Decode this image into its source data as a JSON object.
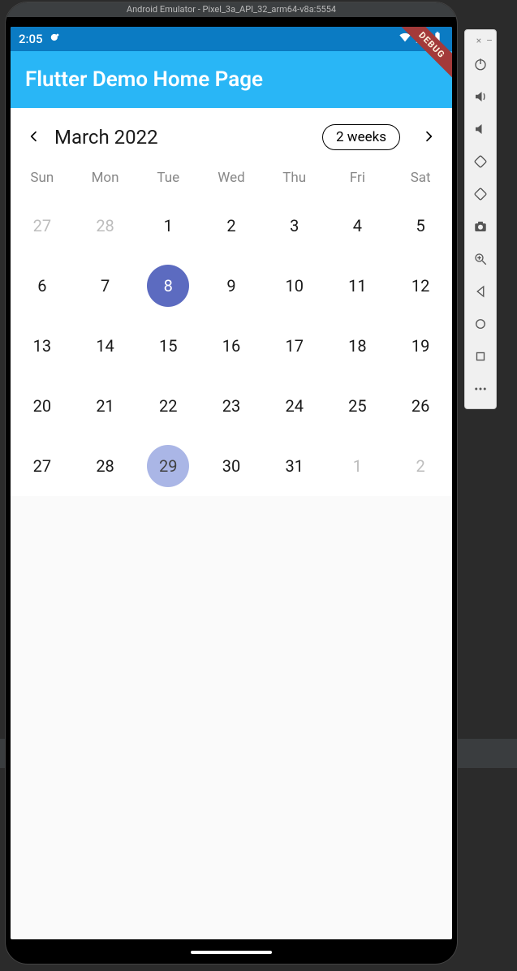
{
  "emulator": {
    "title": "Android Emulator - Pixel_3a_API_32_arm64-v8a:5554",
    "window_close": "×",
    "window_min": "–"
  },
  "status": {
    "time": "2:05"
  },
  "debug_banner": "DEBUG",
  "app": {
    "title": "Flutter Demo Home Page"
  },
  "calendar": {
    "month_label": "March 2022",
    "format_label": "2 weeks",
    "dow": [
      "Sun",
      "Mon",
      "Tue",
      "Wed",
      "Thu",
      "Fri",
      "Sat"
    ],
    "weeks": [
      [
        {
          "d": "27",
          "out": true
        },
        {
          "d": "28",
          "out": true
        },
        {
          "d": "1"
        },
        {
          "d": "2"
        },
        {
          "d": "3"
        },
        {
          "d": "4"
        },
        {
          "d": "5"
        }
      ],
      [
        {
          "d": "6"
        },
        {
          "d": "7"
        },
        {
          "d": "8",
          "selected": true
        },
        {
          "d": "9"
        },
        {
          "d": "10"
        },
        {
          "d": "11"
        },
        {
          "d": "12"
        }
      ],
      [
        {
          "d": "13"
        },
        {
          "d": "14"
        },
        {
          "d": "15"
        },
        {
          "d": "16"
        },
        {
          "d": "17"
        },
        {
          "d": "18"
        },
        {
          "d": "19"
        }
      ],
      [
        {
          "d": "20"
        },
        {
          "d": "21"
        },
        {
          "d": "22"
        },
        {
          "d": "23"
        },
        {
          "d": "24"
        },
        {
          "d": "25"
        },
        {
          "d": "26"
        }
      ],
      [
        {
          "d": "27"
        },
        {
          "d": "28"
        },
        {
          "d": "29",
          "today": true
        },
        {
          "d": "30"
        },
        {
          "d": "31"
        },
        {
          "d": "1",
          "out": true
        },
        {
          "d": "2",
          "out": true
        }
      ]
    ]
  },
  "sidebar_controls": [
    "power",
    "volume-up",
    "volume-down",
    "rotate-left",
    "rotate-right",
    "camera",
    "zoom",
    "back",
    "home",
    "overview",
    "more"
  ]
}
